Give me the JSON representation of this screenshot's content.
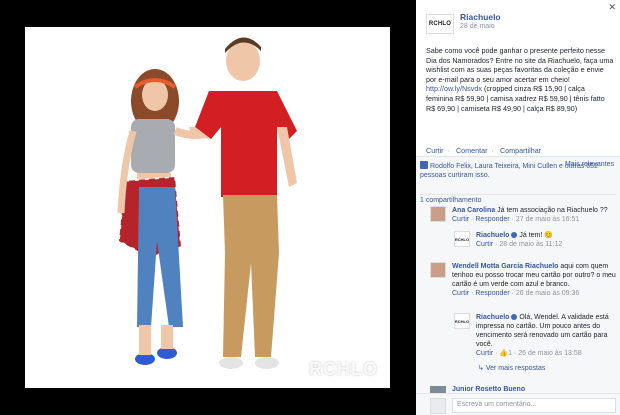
{
  "photo": {
    "watermark": "RCHLO"
  },
  "post": {
    "page_name": "Riachuelo",
    "page_logo_text": "RCHLO",
    "date": "28 de maio",
    "text_before_link": "Sabe como você pode ganhar o presente perfeito nesse Dia dos Namorados? Entre no site da Riachuelo, faça uma wishlist com as suas peças favoritas da coleção e envie por e-mail para o seu amor acertar em cheio!",
    "link": "http://ow.ly/Nsvdx",
    "text_after_link": "(cropped cinza R$ 15,90 | calça feminina R$ 59,90 | camisa xadrez R$ 59,90 | tênis fatto R$ 69,90 | camiseta R$ 49,90 | calça R$ 89,90)",
    "actions": {
      "like": "Curtir",
      "comment": "Comentar",
      "share": "Compartilhar"
    }
  },
  "ufi": {
    "likes_text": "Rodolfo Felix, Laura Teixeira, Mini Cullen e outras 652 pessoas curtiram isso.",
    "most_relevant": "Mais relevantes",
    "shares": "1 compartilhamento"
  },
  "comments": [
    {
      "author": "Ana Carolina",
      "text": "Já tem associação na Riachuelo ??",
      "like": "Curtir",
      "reply": "Responder",
      "time": "27 de maio às 16:51"
    },
    {
      "author": "Riachuelo",
      "text": "Já tem! 😊",
      "like": "Curtir",
      "time": "28 de maio às 11:12"
    },
    {
      "author": "Wendell Motta Garcia Riachuelo",
      "text": "aqui com quem tenhoo eu posso trocar meu cartão por outro? o meu cartão é um verde com azul e branco.",
      "like": "Curtir",
      "reply": "Responder",
      "time": "26 de maio às 09:36"
    },
    {
      "author": "Riachuelo",
      "text": "Olá, Wendel. A validade está impressa no cartão. Um pouco antes do vencimento será renovado um cartão para você.",
      "like": "Curtir",
      "likes_count": "1",
      "time": "26 de maio às 13:58"
    }
  ],
  "more_replies": "Ver mais respostas",
  "partial_comment_author": "Junior Rosetto Bueno",
  "composer": {
    "placeholder": "Escreva um comentário..."
  }
}
